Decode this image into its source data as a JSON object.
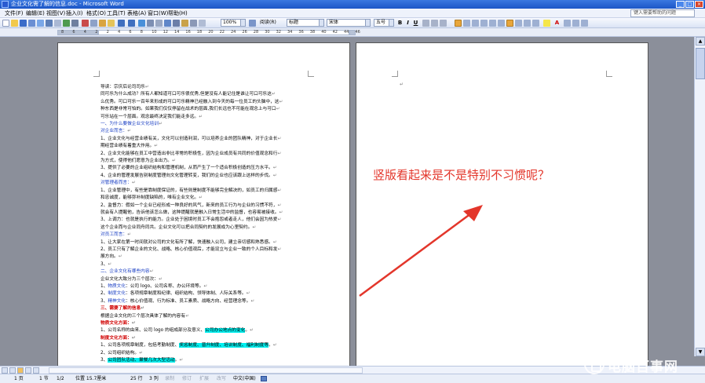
{
  "window": {
    "title": "企业文化需了解的信息.doc - Microsoft Word",
    "controls": [
      "_",
      "□",
      "×"
    ]
  },
  "menu": {
    "items": [
      "文件(F)",
      "编辑(E)",
      "视图(V)",
      "插入(I)",
      "格式(O)",
      "工具(T)",
      "表格(A)",
      "窗口(W)",
      "帮助(H)"
    ],
    "help_placeholder": "键入需要帮助的问题"
  },
  "toolbar": {
    "zoom": "100%",
    "read_label": "阅读(R)",
    "style": "标题",
    "font": "宋体",
    "size": "五号",
    "bold": "B",
    "italic": "I",
    "underline": "U",
    "font_color_glyph": "A"
  },
  "ruler": {
    "numbers": [
      "8",
      "6",
      "4",
      "2",
      "2",
      "4",
      "6",
      "8",
      "10",
      "12",
      "14",
      "16",
      "18",
      "20",
      "22",
      "24",
      "26",
      "28",
      "30",
      "32",
      "34",
      "36",
      "38",
      "40",
      "42",
      "44",
      "46"
    ]
  },
  "document": {
    "return_mark": "↵",
    "lines": [
      {
        "t": "导读：宗庆后论司司乐",
        "c": ""
      },
      {
        "t": "同可乐为什么成功？所有人都知道可口可乐很优秀,但是没有人能记住是谁让可口可乐这",
        "c": ""
      },
      {
        "t": "么优秀。可口可乐一百年来形成的可口可乐精神已经融入到今天的每一位员工的头脑中，这",
        "c": ""
      },
      {
        "t": "种东西是非常可怕的。如果我们仅仅停留在战术的层面,我们长远也不可能在观念上与可口",
        "c": ""
      },
      {
        "t": "可乐站在一个层面。观念最终决定我们能走多远。",
        "c": ""
      },
      {
        "t": "一、为什么要做企业文化培训",
        "c": "blue"
      },
      {
        "t": "对企业而言：",
        "c": "blue"
      },
      {
        "t": "1、企业文化与经营业绩有关，文化可以创造利润，可以培养企业的团队精神，对于企业长",
        "c": ""
      },
      {
        "t": "期经营业绩有着重大作用。",
        "c": ""
      },
      {
        "t": "2、企业文化能够在员工中营造出非比寻常的积极性，因为企业成员有共同的价值观念和行",
        "c": ""
      },
      {
        "t": "为方式，使得他们愿意为企业出力。",
        "c": ""
      },
      {
        "t": "3、提供了必要的企业组织结构和管理机制，从而产生了一个适合积极创造的压力水平。",
        "c": ""
      },
      {
        "t": "4、企业的管理发展告别制度管理向文化管理转变，我们的企业也应该跟上这样的步伐。",
        "c": ""
      },
      {
        "t": "对管理者而言：",
        "c": "blue"
      },
      {
        "t": "1、企业管理中，有些是靠制度保证的，有些则是制度不能够完全解决的，如员工的归属感",
        "c": ""
      },
      {
        "t": "和忠诚度，能够弥补制度缺陷的，唯有企业文化。",
        "c": ""
      },
      {
        "t": "2、监督力：假如一个企业已经形成一种良好的风气，新来的员工行为与企业的习惯不符，",
        "c": ""
      },
      {
        "t": "就会有人提醒他，告诉他该怎么做，这种提醒就是融入日常生活中的监督，也容易被接收。",
        "c": ""
      },
      {
        "t": "3、上调力：也就是执行的能力。企业处于困境时员工不会抱怨或者走人，他们会因为热爱",
        "c": ""
      },
      {
        "t": "这个企业而与企业同舟同共。企业文化可以把合同契约的发展成为心里契约。",
        "c": ""
      },
      {
        "t": "对员工而言：",
        "c": "blue"
      },
      {
        "t": "1、让大家在第一时间就对公司的文化有所了解，快速融入公司，建立亲切感和熟悉感。",
        "c": ""
      },
      {
        "t": "2、员工只有了解企业的文化、战略、核心价值观后，才能设立与企业一致的个人目标和发",
        "c": ""
      },
      {
        "t": "展方向。",
        "c": ""
      },
      {
        "t": "3、",
        "c": ""
      },
      {
        "t": "二、企业文化有哪些内容",
        "c": "blue"
      },
      {
        "t": "企业文化大致分为三个层次：",
        "c": ""
      },
      {
        "t": "1、物质文化：公司 logo、公司名称、办公环境等。",
        "c": "",
        "p": "物质文化",
        "pc": "blue"
      },
      {
        "t": "2、制度文化：各项规章制度和纪律、组织结构、领导体制、人际关系等。",
        "c": "",
        "p": "制度文化",
        "pc": "blue"
      },
      {
        "t": "3、精神文化：核心价值观、行为标准、员工素质、战略方向、经营理念等。",
        "c": "",
        "p": "精神文化",
        "pc": "blue"
      },
      {
        "t": "三、需要了解的信息",
        "c": "red"
      },
      {
        "t": "根据企业文化的三个层次具体了解的内容有",
        "c": ""
      },
      {
        "t": "物质文化方面：",
        "c": "red"
      },
      {
        "t": "1、公司名称的由来、公司 logo 的组成部分及意义、公司办公地点的变化。",
        "c": "",
        "h": "公司办公地点的变化"
      },
      {
        "t": "制度文化方面：",
        "c": "red"
      },
      {
        "t": "1、公司各项规章制度，包括考勤制度、奖惩制度、晋升制度、培训制度、福利制度等。",
        "c": "",
        "h": "奖惩制度、晋升制度、培训制度、福利制度等"
      },
      {
        "t": "2、公司组织结构。",
        "c": ""
      },
      {
        "t": "3、公司团队活动、聚餐几次大型活动。",
        "c": "",
        "h": "公司团队活动、聚餐几次大型活动"
      }
    ]
  },
  "annotation": {
    "text": "竖版看起来是不是特别不习惯呢？",
    "color": "#e3362b"
  },
  "statusbar": {
    "page": "1 页",
    "section": "1 节",
    "pages": "1/2",
    "position": "位置 15.7厘米",
    "line": "25 行",
    "column": "3 列",
    "rec": "录制",
    "trk": "修订",
    "ext": "扩展",
    "ovr": "改写",
    "lang": "中文(中国)"
  },
  "watermark": {
    "text": "电脑百事网"
  }
}
